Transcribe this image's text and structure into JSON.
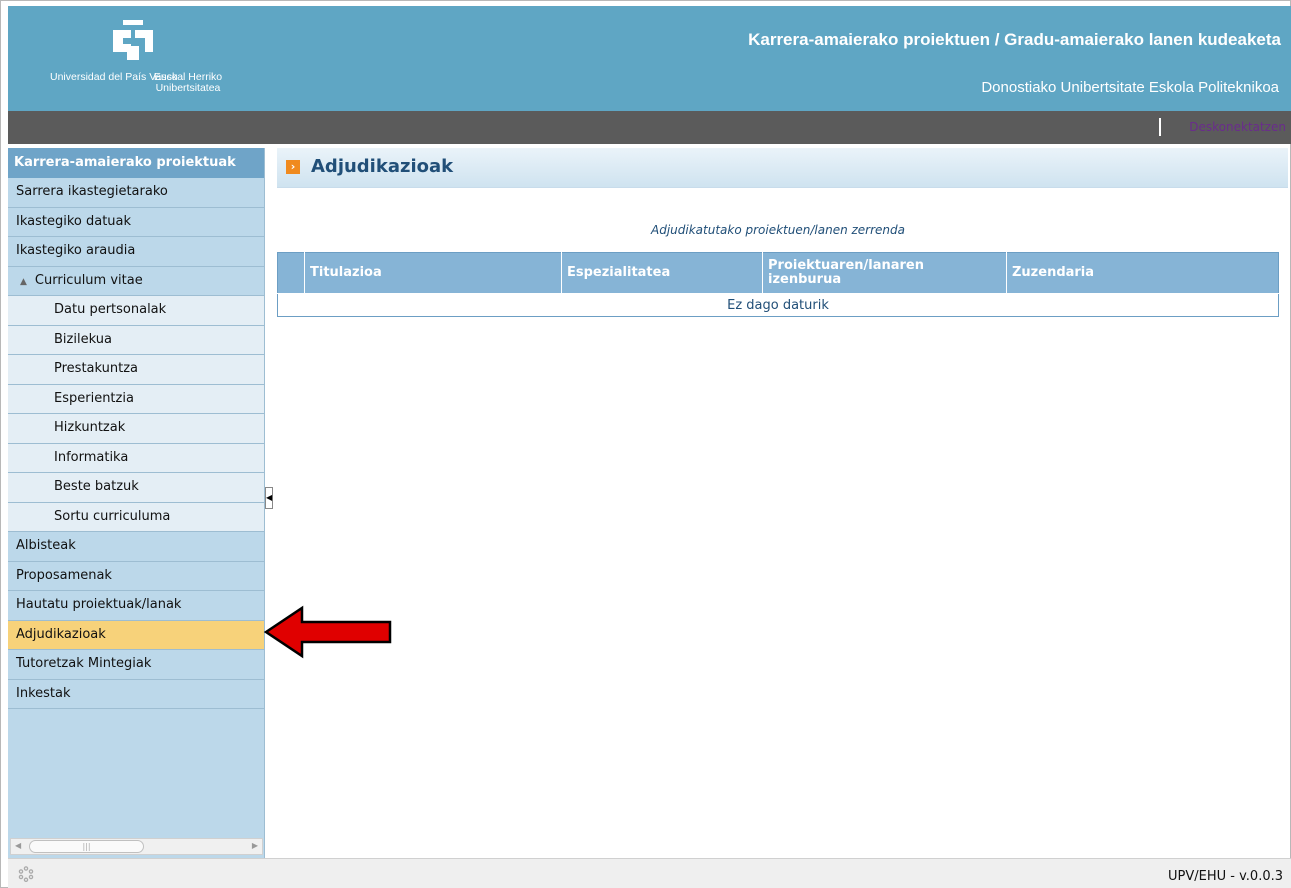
{
  "header": {
    "title": "Karrera-amaierako proiektuen / Gradu-amaierako lanen kudeaketa",
    "subtitle": "Donostiako Unibertsitate Eskola Politeknikoa",
    "logo_left": "Universidad del País Vasco",
    "logo_right": "Euskal Herriko Unibertsitatea"
  },
  "topbar": {
    "logout_label": "Deskonektatzen",
    "logout_color": "#6a2c8c"
  },
  "sidebar": {
    "header": "Karrera-amaierako proiektuak",
    "items": [
      {
        "label": "Sarrera ikastegietarako"
      },
      {
        "label": "Ikastegiko datuak"
      },
      {
        "label": "Ikastegiko araudia"
      },
      {
        "label": "Curriculum vitae"
      },
      {
        "label": "Datu pertsonalak"
      },
      {
        "label": "Bizilekua"
      },
      {
        "label": "Prestakuntza"
      },
      {
        "label": "Esperientzia"
      },
      {
        "label": "Hizkuntzak"
      },
      {
        "label": "Informatika"
      },
      {
        "label": "Beste batzuk"
      },
      {
        "label": "Sortu curriculuma"
      },
      {
        "label": "Albisteak"
      },
      {
        "label": "Proposamenak"
      },
      {
        "label": "Hautatu proiektuak/lanak"
      },
      {
        "label": "Adjudikazioak"
      },
      {
        "label": "Tutoretzak Mintegiak"
      },
      {
        "label": "Inkestak"
      }
    ],
    "active_color": "#f7d27a"
  },
  "main": {
    "title": "Adjudikazioak",
    "table_caption": "Adjudikatutako proiektuen/lanen zerrenda",
    "columns": [
      "Titulazioa",
      "Espezialitatea",
      "Proiektuaren/lanaren izenburua",
      "Zuzendaria"
    ],
    "empty_message": "Ez dago daturik"
  },
  "footer": {
    "version": "UPV/EHU - v.0.0.3"
  },
  "colors": {
    "header_bg": "#5fa6c4",
    "sidebar_bg": "#bcd8ea",
    "table_header_bg": "#86b4d6",
    "arrow": "#e00000"
  }
}
